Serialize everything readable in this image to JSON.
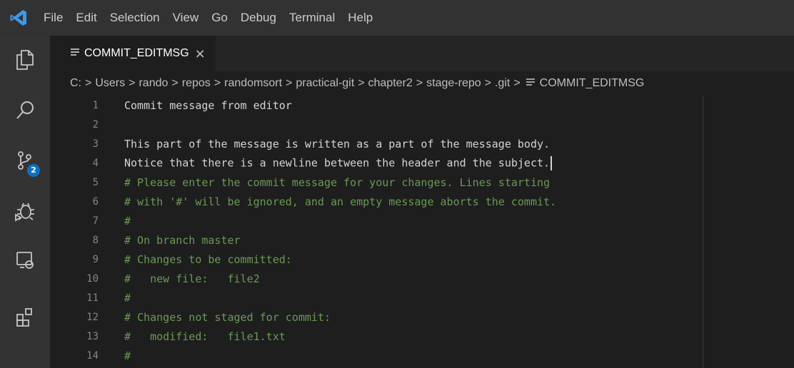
{
  "menu": {
    "items": [
      "File",
      "Edit",
      "Selection",
      "View",
      "Go",
      "Debug",
      "Terminal",
      "Help"
    ]
  },
  "activity_bar": {
    "icons": [
      "explorer-icon",
      "search-icon",
      "source-control-icon",
      "debug-icon",
      "remote-explorer-icon",
      "extensions-icon"
    ],
    "source_control_badge": "2",
    "badge_color": "#0e70c0"
  },
  "tab": {
    "label": "COMMIT_EDITMSG",
    "close": "×"
  },
  "breadcrumb": {
    "items": [
      "C:",
      "Users",
      "rando",
      "repos",
      "randomsort",
      "practical-git",
      "chapter2",
      "stage-repo",
      ".git",
      "COMMIT_EDITMSG"
    ],
    "separator": ">"
  },
  "editor": {
    "lines": [
      {
        "n": "1",
        "text": "Commit message from editor",
        "comment": false
      },
      {
        "n": "2",
        "text": "",
        "comment": false
      },
      {
        "n": "3",
        "text": "This part of the message is written as a part of the message body.",
        "comment": false
      },
      {
        "n": "4",
        "text": "Notice that there is a newline between the header and the subject.",
        "comment": false
      },
      {
        "n": "5",
        "text": "# Please enter the commit message for your changes. Lines starting",
        "comment": true
      },
      {
        "n": "6",
        "text": "# with '#' will be ignored, and an empty message aborts the commit.",
        "comment": true
      },
      {
        "n": "7",
        "text": "#",
        "comment": true
      },
      {
        "n": "8",
        "text": "# On branch master",
        "comment": true
      },
      {
        "n": "9",
        "text": "# Changes to be committed:",
        "comment": true
      },
      {
        "n": "10",
        "text": "#   new file:   file2",
        "comment": true
      },
      {
        "n": "11",
        "text": "#",
        "comment": true
      },
      {
        "n": "12",
        "text": "# Changes not staged for commit:",
        "comment": true
      },
      {
        "n": "13",
        "text": "#   modified:   file1.txt",
        "comment": true
      },
      {
        "n": "14",
        "text": "#",
        "comment": true
      }
    ],
    "colors": {
      "text": "#d4d4d4",
      "comment": "#6a9955",
      "line_number": "#858585"
    }
  }
}
